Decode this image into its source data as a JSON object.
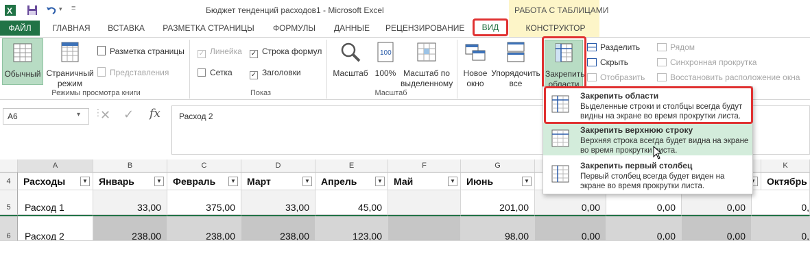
{
  "window": {
    "title": "Бюджет тенденций расходов1 - Microsoft Excel",
    "context_group": "РАБОТА С ТАБЛИЦАМИ"
  },
  "tabs": [
    "ФАЙЛ",
    "ГЛАВНАЯ",
    "ВСТАВКА",
    "РАЗМЕТКА СТРАНИЦЫ",
    "ФОРМУЛЫ",
    "ДАННЫЕ",
    "РЕЦЕНЗИРОВАНИЕ",
    "ВИД",
    "КОНСТРУКТОР"
  ],
  "ribbon": {
    "views": {
      "normal": "Обычный",
      "page_layout_line1": "Страничный",
      "page_layout_line2": "режим",
      "page_markup": "Разметка страницы",
      "custom_views": "Представления",
      "group": "Режимы просмотра книги"
    },
    "show": {
      "ruler": "Линейка",
      "formula_bar": "Строка формул",
      "gridlines": "Сетка",
      "headings": "Заголовки",
      "group": "Показ"
    },
    "zoom": {
      "zoom": "Масштаб",
      "hundred": "100%",
      "to_selection_line1": "Масштаб по",
      "to_selection_line2": "выделенному",
      "group": "Масштаб"
    },
    "window": {
      "new_line1": "Новое",
      "new_line2": "окно",
      "arrange_line1": "Упорядочить",
      "arrange_line2": "все",
      "freeze_line1": "Закрепить",
      "freeze_line2": "области",
      "split": "Разделить",
      "hide": "Скрыть",
      "unhide": "Отобразить",
      "side_by_side": "Рядом",
      "sync_scroll": "Синхронная прокрутка",
      "reset_position": "Восстановить расположение окна"
    }
  },
  "formula_bar": {
    "name_box": "A6",
    "content": "Расход 2"
  },
  "freeze_menu": [
    {
      "title": "Закрепить области",
      "desc": "Выделенные строки и столбцы всегда будут видны на экране во время прокрутки листа."
    },
    {
      "title": "Закрепить верхнюю строку",
      "desc": "Верхняя строка всегда будет видна на экране во время прокрутки листа."
    },
    {
      "title": "Закрепить первый столбец",
      "desc": "Первый столбец всегда будет виден на экране во время прокрутки листа."
    }
  ],
  "sheet": {
    "columns": [
      "A",
      "B",
      "C",
      "D",
      "E",
      "F",
      "G",
      "K"
    ],
    "rows": [
      "4",
      "5",
      "6"
    ],
    "header_row": [
      "Расходы",
      "Январь",
      "Февраль",
      "Март",
      "Апрель",
      "Май",
      "Июнь",
      "Октябрь"
    ],
    "row5": [
      "Расход 1",
      "33,00",
      "375,00",
      "33,00",
      "45,00",
      "",
      "201,00",
      "0,00",
      "0,00",
      "0,00",
      "0,"
    ],
    "row6": [
      "Расход 2",
      "238,00",
      "238,00",
      "238,00",
      "123,00",
      "",
      "98,00",
      "0,00",
      "0,00",
      "0,00",
      "0,"
    ]
  }
}
